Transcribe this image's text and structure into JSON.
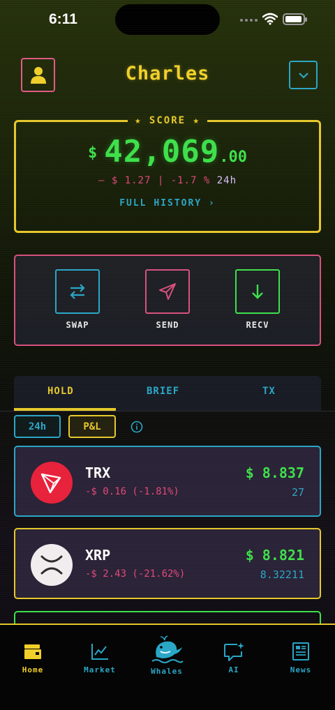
{
  "status": {
    "time": "6:11"
  },
  "header": {
    "user_name": "Charles"
  },
  "score": {
    "label": "★ SCORE ★",
    "currency": "$",
    "value": "42,069",
    "cents": ".00",
    "change": "– $ 1.27 | -1.7 %",
    "period": "24h",
    "history_link": "FULL HISTORY ›"
  },
  "actions": [
    {
      "label": "SWAP",
      "icon": "swap-icon",
      "color": "#2aa6c6"
    },
    {
      "label": "SEND",
      "icon": "send-icon",
      "color": "#d8507c"
    },
    {
      "label": "RECV",
      "icon": "receive-icon",
      "color": "#3de04a"
    }
  ],
  "tabs": [
    {
      "label": "HOLD",
      "active": true
    },
    {
      "label": "BRIEF",
      "active": false
    },
    {
      "label": "TX",
      "active": false
    }
  ],
  "filters": {
    "range": "24h",
    "mode": "P&L"
  },
  "assets": [
    {
      "symbol": "TRX",
      "change": "-$ 0.16 (-1.81%)",
      "price": "$ 8.837",
      "qty": "27",
      "border": "#2aa6c6"
    },
    {
      "symbol": "XRP",
      "change": "-$ 2.43 (-21.62%)",
      "price": "$ 8.821",
      "qty": "8.32211",
      "border": "#e5c82b"
    }
  ],
  "nav": [
    {
      "label": "Home",
      "icon": "wallet-icon",
      "active": true
    },
    {
      "label": "Market",
      "icon": "chart-icon",
      "active": false
    },
    {
      "label": "Whales",
      "icon": "whale-icon",
      "active": false
    },
    {
      "label": "AI",
      "icon": "ai-chat-icon",
      "active": false
    },
    {
      "label": "News",
      "icon": "news-icon",
      "active": false
    }
  ],
  "colors": {
    "yellow": "#e5c82b",
    "green": "#3de04a",
    "cyan": "#2aa6c6",
    "pink": "#d8507c"
  }
}
